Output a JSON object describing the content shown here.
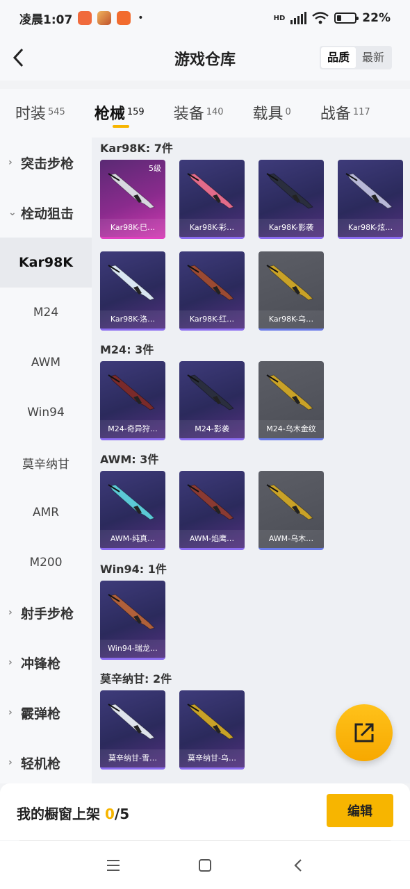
{
  "status_bar": {
    "time": "凌晨1:07",
    "battery": "22%",
    "battery_level": 0.22,
    "network": "HD"
  },
  "header": {
    "title": "游戏仓库",
    "sort": {
      "options": [
        "品质",
        "最新"
      ],
      "active": 0
    }
  },
  "tabs": [
    {
      "label": "时装",
      "count": "545"
    },
    {
      "label": "枪械",
      "count": "159"
    },
    {
      "label": "装备",
      "count": "140"
    },
    {
      "label": "载具",
      "count": "0"
    },
    {
      "label": "战备",
      "count": "117"
    }
  ],
  "active_tab": 1,
  "sidenav": [
    {
      "type": "group",
      "label": "突击步枪",
      "expanded": false
    },
    {
      "type": "group",
      "label": "栓动狙击",
      "expanded": true
    },
    {
      "type": "sub",
      "label": "Kar98K",
      "active": true
    },
    {
      "type": "sub",
      "label": "M24"
    },
    {
      "type": "sub",
      "label": "AWM"
    },
    {
      "type": "sub",
      "label": "Win94"
    },
    {
      "type": "sub",
      "label": "莫辛纳甘"
    },
    {
      "type": "sub",
      "label": "AMR"
    },
    {
      "type": "sub",
      "label": "M200"
    },
    {
      "type": "group",
      "label": "射手步枪",
      "expanded": false
    },
    {
      "type": "group",
      "label": "冲锋枪",
      "expanded": false
    },
    {
      "type": "group",
      "label": "霰弹枪",
      "expanded": false
    },
    {
      "type": "group",
      "label": "轻机枪",
      "expanded": false
    }
  ],
  "sections": [
    {
      "title": "Kar98K: 7件",
      "items": [
        {
          "name": "Kar98K-巳…",
          "rarity": "pink",
          "level": "5级",
          "gun_color": "#d8d8e0"
        },
        {
          "name": "Kar98K-彩…",
          "rarity": "purple",
          "gun_color": "#e36b8a"
        },
        {
          "name": "Kar98K-影袭",
          "rarity": "purple",
          "gun_color": "#2a2e3e"
        },
        {
          "name": "Kar98K-炫…",
          "rarity": "purple",
          "gun_color": "#b8b8d8"
        },
        {
          "name": "Kar98K-洛…",
          "rarity": "purple",
          "gun_color": "#d9e6f2"
        },
        {
          "name": "Kar98K-红…",
          "rarity": "purple",
          "gun_color": "#9b4a32"
        },
        {
          "name": "Kar98K-乌…",
          "rarity": "gray",
          "gun_color": "#c9a227"
        }
      ]
    },
    {
      "title": "M24: 3件",
      "items": [
        {
          "name": "M24-奇异狩…",
          "rarity": "purple",
          "gun_color": "#7a2a2a"
        },
        {
          "name": "M24-影袭",
          "rarity": "purple",
          "gun_color": "#2a2e3e"
        },
        {
          "name": "M24-乌木金纹",
          "rarity": "gray",
          "gun_color": "#c9a227"
        }
      ]
    },
    {
      "title": "AWM: 3件",
      "items": [
        {
          "name": "AWM-纯真…",
          "rarity": "purple",
          "gun_color": "#5bc9d6"
        },
        {
          "name": "AWM-焰鹰…",
          "rarity": "purple",
          "gun_color": "#8a3a32"
        },
        {
          "name": "AWM-乌木…",
          "rarity": "gray",
          "gun_color": "#c9a227"
        }
      ]
    },
    {
      "title": "Win94: 1件",
      "items": [
        {
          "name": "Win94-瑞龙…",
          "rarity": "purple",
          "gun_color": "#b0603a"
        }
      ]
    },
    {
      "title": "莫辛纳甘: 2件",
      "items": [
        {
          "name": "莫辛纳甘-雪…",
          "rarity": "purple",
          "gun_color": "#dfe4ec"
        },
        {
          "name": "莫辛纳甘-乌…",
          "rarity": "purple",
          "gun_color": "#c9a227"
        }
      ]
    }
  ],
  "bottom": {
    "label": "我的橱窗上架 ",
    "current": "0",
    "total": "/5",
    "edit_label": "编辑"
  },
  "icons": {
    "back": "back-arrow-icon",
    "fab": "share-icon",
    "nav_menu": "menu-icon",
    "nav_home": "home-icon",
    "nav_back": "back-icon"
  },
  "colors": {
    "accent": "#f7b500",
    "rarity_purple": "#8b6cf0",
    "rarity_pink": "#e040c0",
    "rarity_gray": "#6a7be8"
  }
}
